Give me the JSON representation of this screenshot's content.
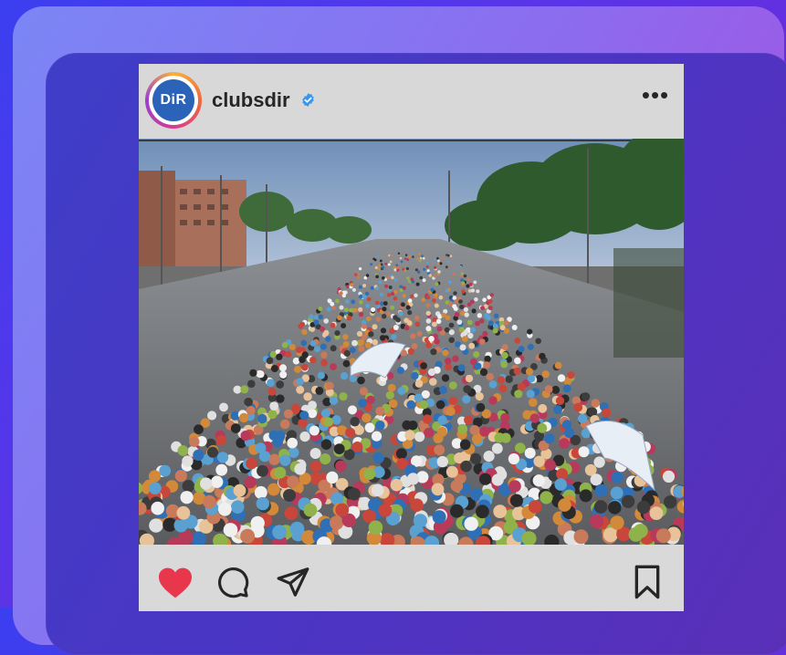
{
  "post": {
    "avatar_text": "DiR",
    "username": "clubsdir",
    "more_label": "•••",
    "photo_alt": "Marathon start line crowd of runners with raised arms"
  },
  "actions": {
    "like_icon": "heart-filled-icon",
    "comment_icon": "comment-icon",
    "share_icon": "send-icon",
    "save_icon": "bookmark-icon"
  },
  "colors": {
    "like": "#e8364c",
    "verified": "#3797f0",
    "text": "#262626"
  }
}
